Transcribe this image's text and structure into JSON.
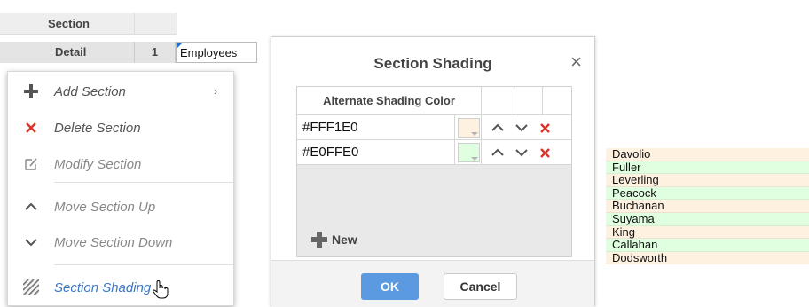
{
  "grid": {
    "header_label": "Section",
    "detail_label": "Detail",
    "row_number": "1",
    "field_text": "Employees"
  },
  "context_menu": {
    "items": [
      {
        "label": "Add Section",
        "icon": "plus-icon",
        "has_submenu": true,
        "enabled": true
      },
      {
        "label": "Delete Section",
        "icon": "delete-x-icon",
        "enabled": true
      },
      {
        "label": "Modify Section",
        "icon": "edit-icon",
        "enabled": false
      },
      {
        "label": "Move Section Up",
        "icon": "chevron-up-icon",
        "enabled": false
      },
      {
        "label": "Move Section Down",
        "icon": "chevron-down-icon",
        "enabled": false
      },
      {
        "label": "Section Shading",
        "icon": "shading-icon",
        "enabled": true
      }
    ]
  },
  "dialog": {
    "title": "Section Shading",
    "column_header": "Alternate Shading Color",
    "rows": [
      {
        "value": "#FFF1E0",
        "color": "#FFF1E0"
      },
      {
        "value": "#E0FFE0",
        "color": "#E0FFE0"
      }
    ],
    "new_label": "New",
    "ok_label": "OK",
    "cancel_label": "Cancel"
  },
  "preview": {
    "colors": [
      "#FFF1E0",
      "#E0FFE0"
    ],
    "names": [
      "Davolio",
      "Fuller",
      "Leverling",
      "Peacock",
      "Buchanan",
      "Suyama",
      "King",
      "Callahan",
      "Dodsworth"
    ]
  },
  "colors": {
    "accent": "#3a78c8",
    "ok_button": "#5b9ae0",
    "delete_red": "#d9342b"
  }
}
